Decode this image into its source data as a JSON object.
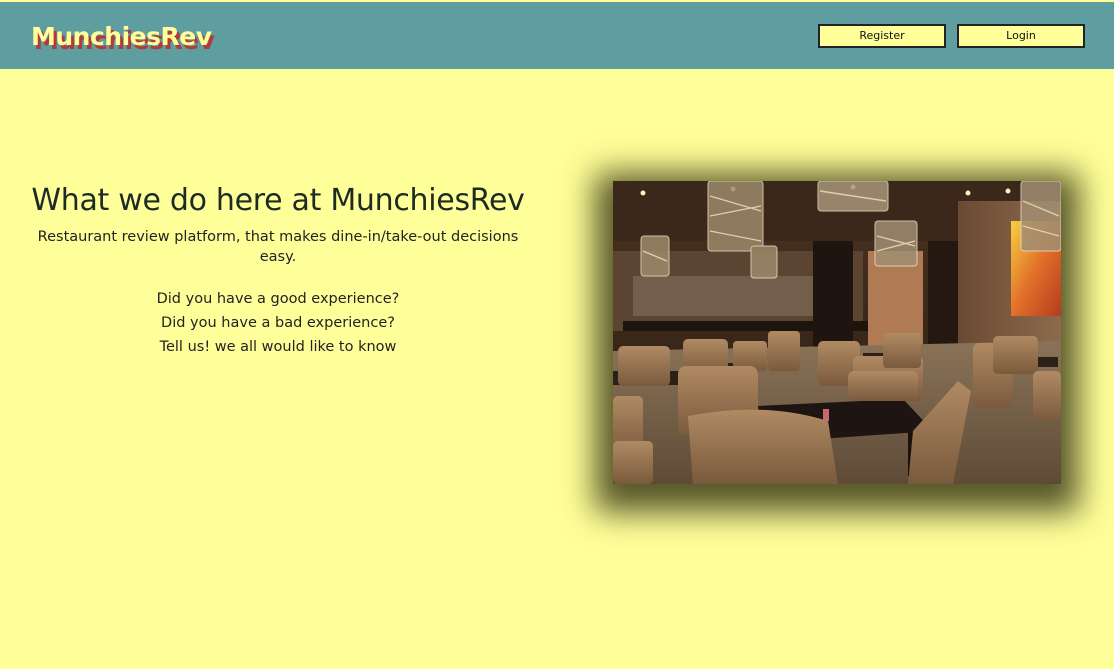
{
  "header": {
    "brand": "MunchiesRev",
    "register_label": "Register",
    "login_label": "Login"
  },
  "main": {
    "heading": "What we do here at MunchiesRev",
    "tagline": "Restaurant review platform, that makes dine-in/take-out decisions easy.",
    "lines": [
      "Did you have a good experience?",
      "Did you have a bad experience?",
      "Tell us! we all would like to know"
    ]
  },
  "image": {
    "subject": "restaurant-interior-photo"
  },
  "colors": {
    "page_background": "#ffff99",
    "header_background": "#5f9ea0",
    "brand_text": "#ffff99",
    "brand_shadow": "#b23a3a"
  }
}
